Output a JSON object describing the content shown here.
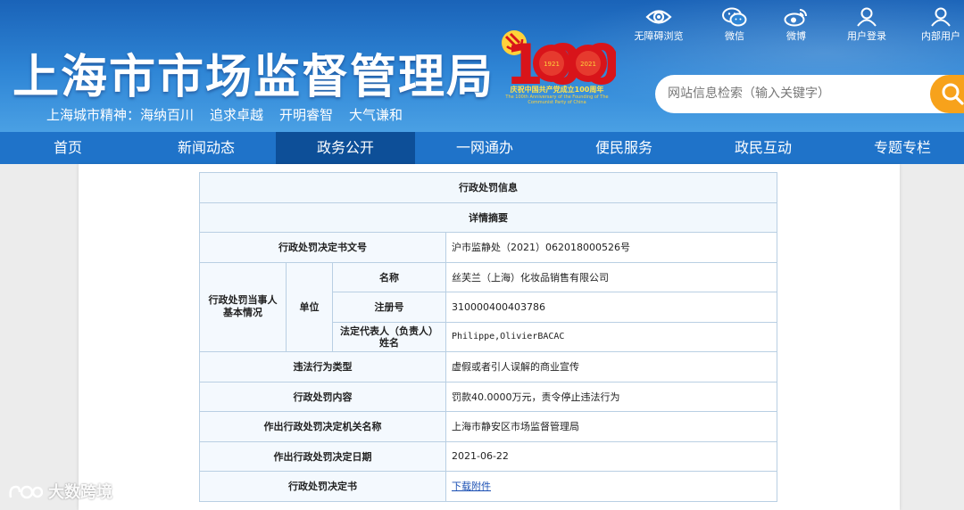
{
  "header": {
    "site_title": "上海市市场监督管理局",
    "slogans": [
      "上海城市精神：海纳百川",
      "追求卓越",
      "开明睿智",
      "大气谦和"
    ],
    "anniversary_logo": {
      "numeral": "100",
      "years": [
        "1921",
        "2021"
      ],
      "caption_cn": "庆祝中国共产党成立100周年",
      "caption_en": "The 100th Anniversary of the Founding of The Communist Party of China"
    },
    "top_links": [
      {
        "label": "无障碍浏览",
        "icon": "eye-icon"
      },
      {
        "label": "微信",
        "icon": "wechat-icon"
      },
      {
        "label": "微博",
        "icon": "weibo-icon"
      },
      {
        "label": "用户登录",
        "icon": "user-icon"
      },
      {
        "label": "内部用户",
        "icon": "user-icon"
      }
    ],
    "search": {
      "placeholder": "网站信息检索（输入关键字）",
      "icon": "search-icon"
    }
  },
  "nav": {
    "items": [
      "首页",
      "新闻动态",
      "政务公开",
      "一网通办",
      "便民服务",
      "政民互动",
      "专题专栏"
    ],
    "active": "政务公开"
  },
  "table": {
    "title": "行政处罚信息",
    "subtitle": "详情摘要",
    "doc_no_label": "行政处罚决定书文号",
    "doc_no_value": "沪市监静处（2021）062018000526号",
    "party_label": "行政处罚当事人基本情况",
    "unit_label": "单位",
    "name_label": "名称",
    "name_value": "丝芙兰（上海）化妆品销售有限公司",
    "reg_label": "注册号",
    "reg_value": "310000400403786",
    "rep_label": "法定代表人（负责人）姓名",
    "rep_value": "Philippe,OlivierBACAC",
    "type_label": "违法行为类型",
    "type_value": "虚假或者引人误解的商业宣传",
    "content_label": "行政处罚内容",
    "content_value": "罚款40.0000万元，责令停止违法行为",
    "org_label": "作出行政处罚决定机关名称",
    "org_value": "上海市静安区市场监督管理局",
    "date_label": "作出行政处罚决定日期",
    "date_value": "2021-06-22",
    "doc_label": "行政处罚决定书",
    "doc_link": "下载附件"
  },
  "watermark": {
    "text": "大数跨境"
  },
  "colors": {
    "header_blue": "#2f86d6",
    "nav_blue": "#1f73c9",
    "nav_active": "#0d4f98",
    "search_button": "#f7a21b",
    "logo_red": "#d8141a",
    "table_border": "#b9cfe3"
  }
}
